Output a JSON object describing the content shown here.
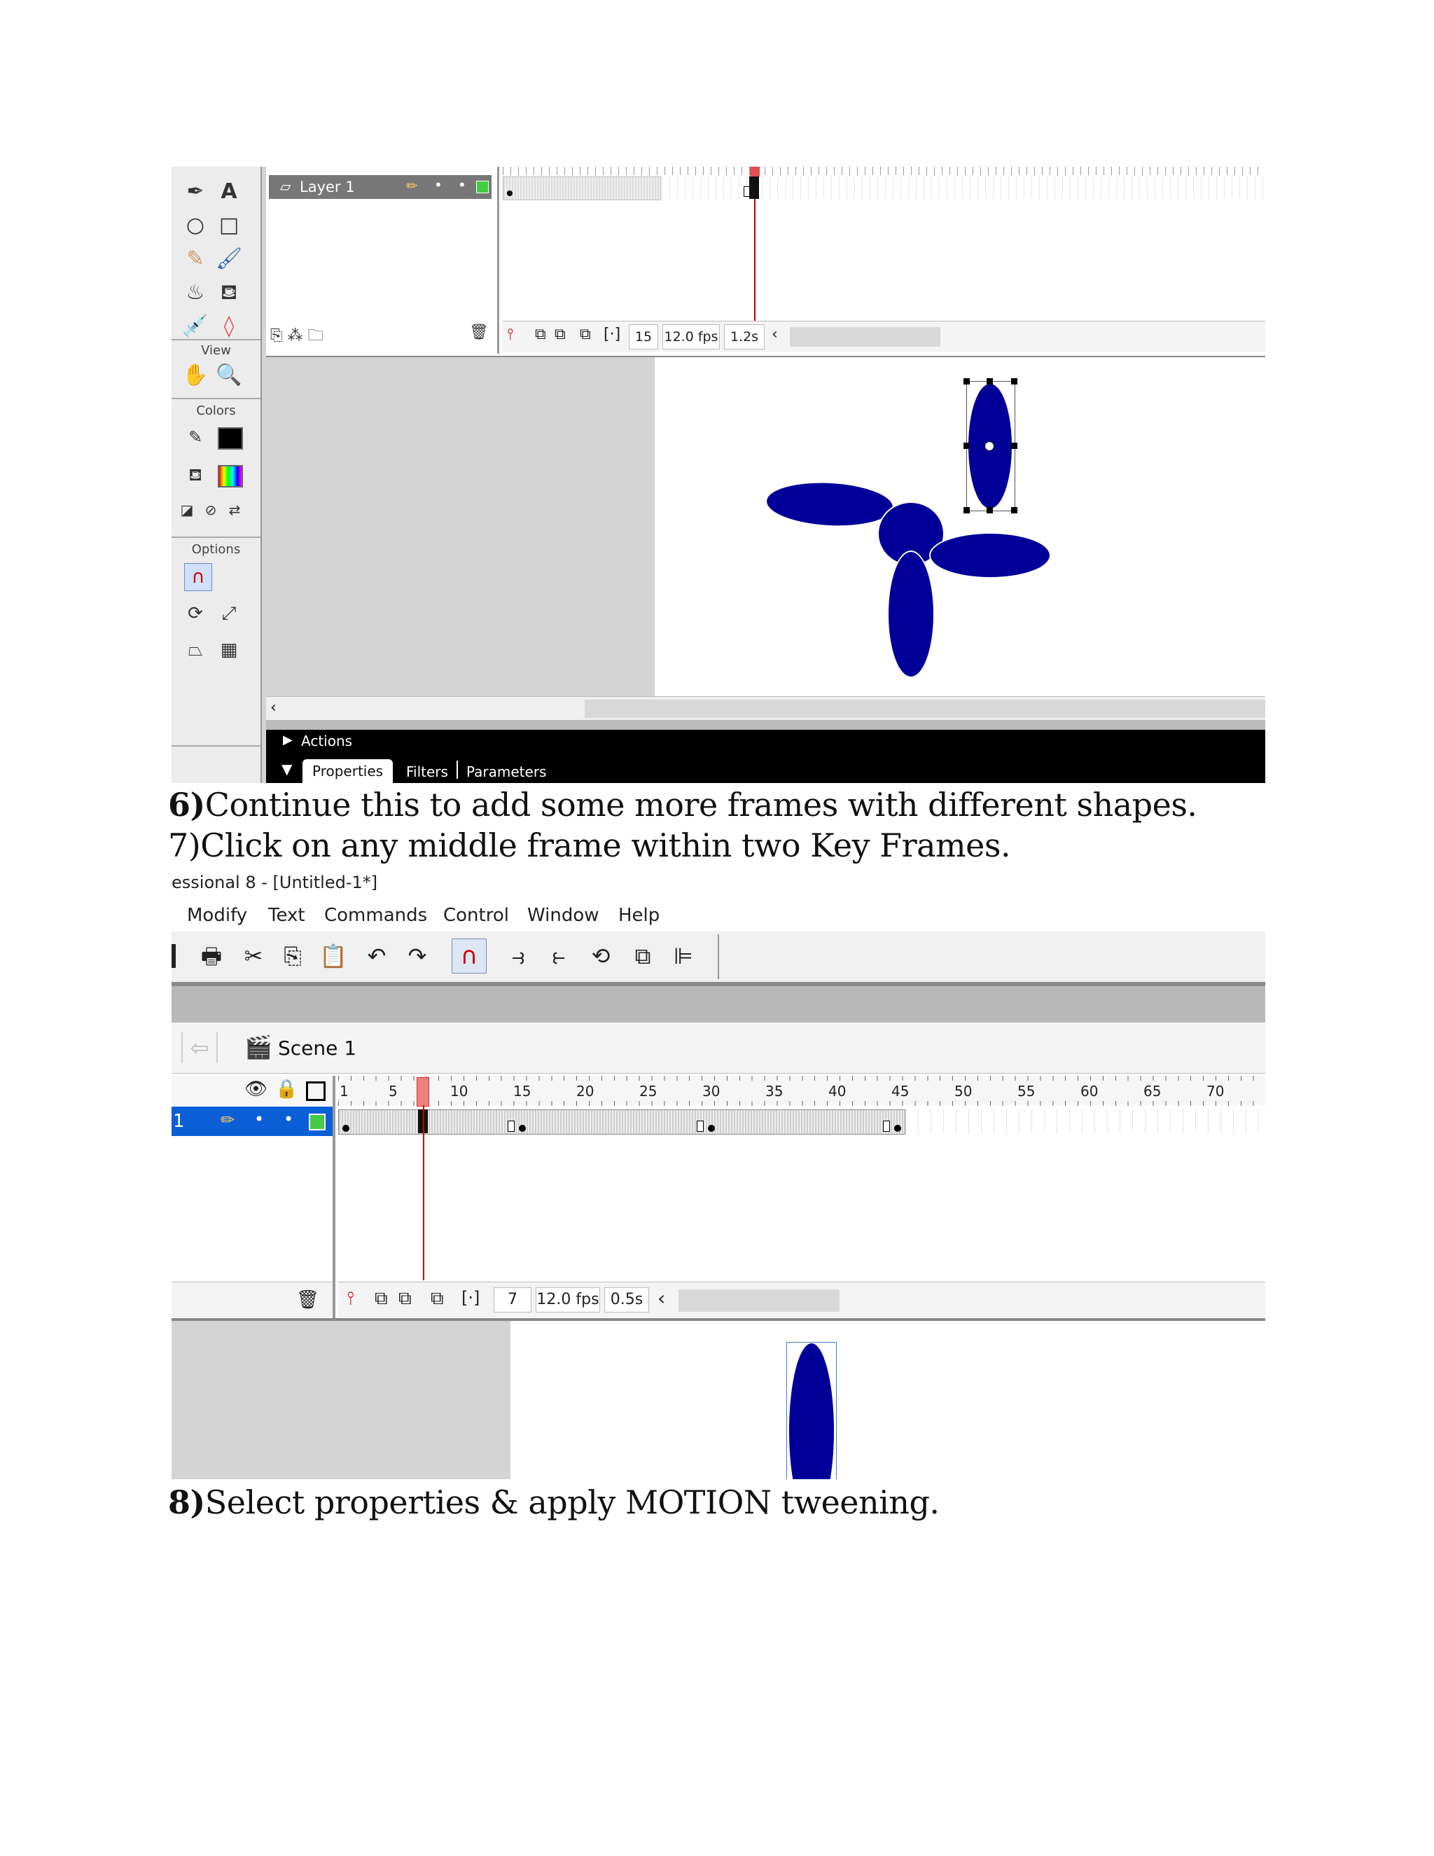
{
  "screenshot1": {
    "layer": {
      "name": "Layer 1"
    },
    "toolbox": {
      "text_tool": "A",
      "view_label": "View",
      "colors_label": "Colors",
      "options_label": "Options"
    },
    "status": {
      "frame": "15",
      "fps": "12.0 fps",
      "time": "1.2s"
    },
    "panels": {
      "actions_label": "Actions",
      "tabs": [
        "Properties",
        "Filters",
        "Parameters"
      ]
    }
  },
  "instructions": {
    "step6_num": "6)",
    "step6_text": "Continue this to add some more frames with different shapes.",
    "step7_text": "7)Click on any middle frame within two Key Frames.",
    "step8_num": "8)",
    "step8_text": "Select properties & apply MOTION tweening."
  },
  "screenshot2": {
    "window_title": "essional 8 - [Untitled-1*]",
    "menu": [
      "Modify",
      "Text",
      "Commands",
      "Control",
      "Window",
      "Help"
    ],
    "scene_label": "Scene 1",
    "ruler": [
      "1",
      "5",
      "10",
      "15",
      "20",
      "25",
      "30",
      "35",
      "40",
      "45",
      "50",
      "55",
      "60",
      "65",
      "70"
    ],
    "layer_num": "1",
    "status": {
      "frame": "7",
      "fps": "12.0 fps",
      "time": "0.5s"
    }
  },
  "colors": {
    "shape_fill": "#000099",
    "playhead": "#e05050",
    "layer_selected": "#0a5fd6"
  }
}
